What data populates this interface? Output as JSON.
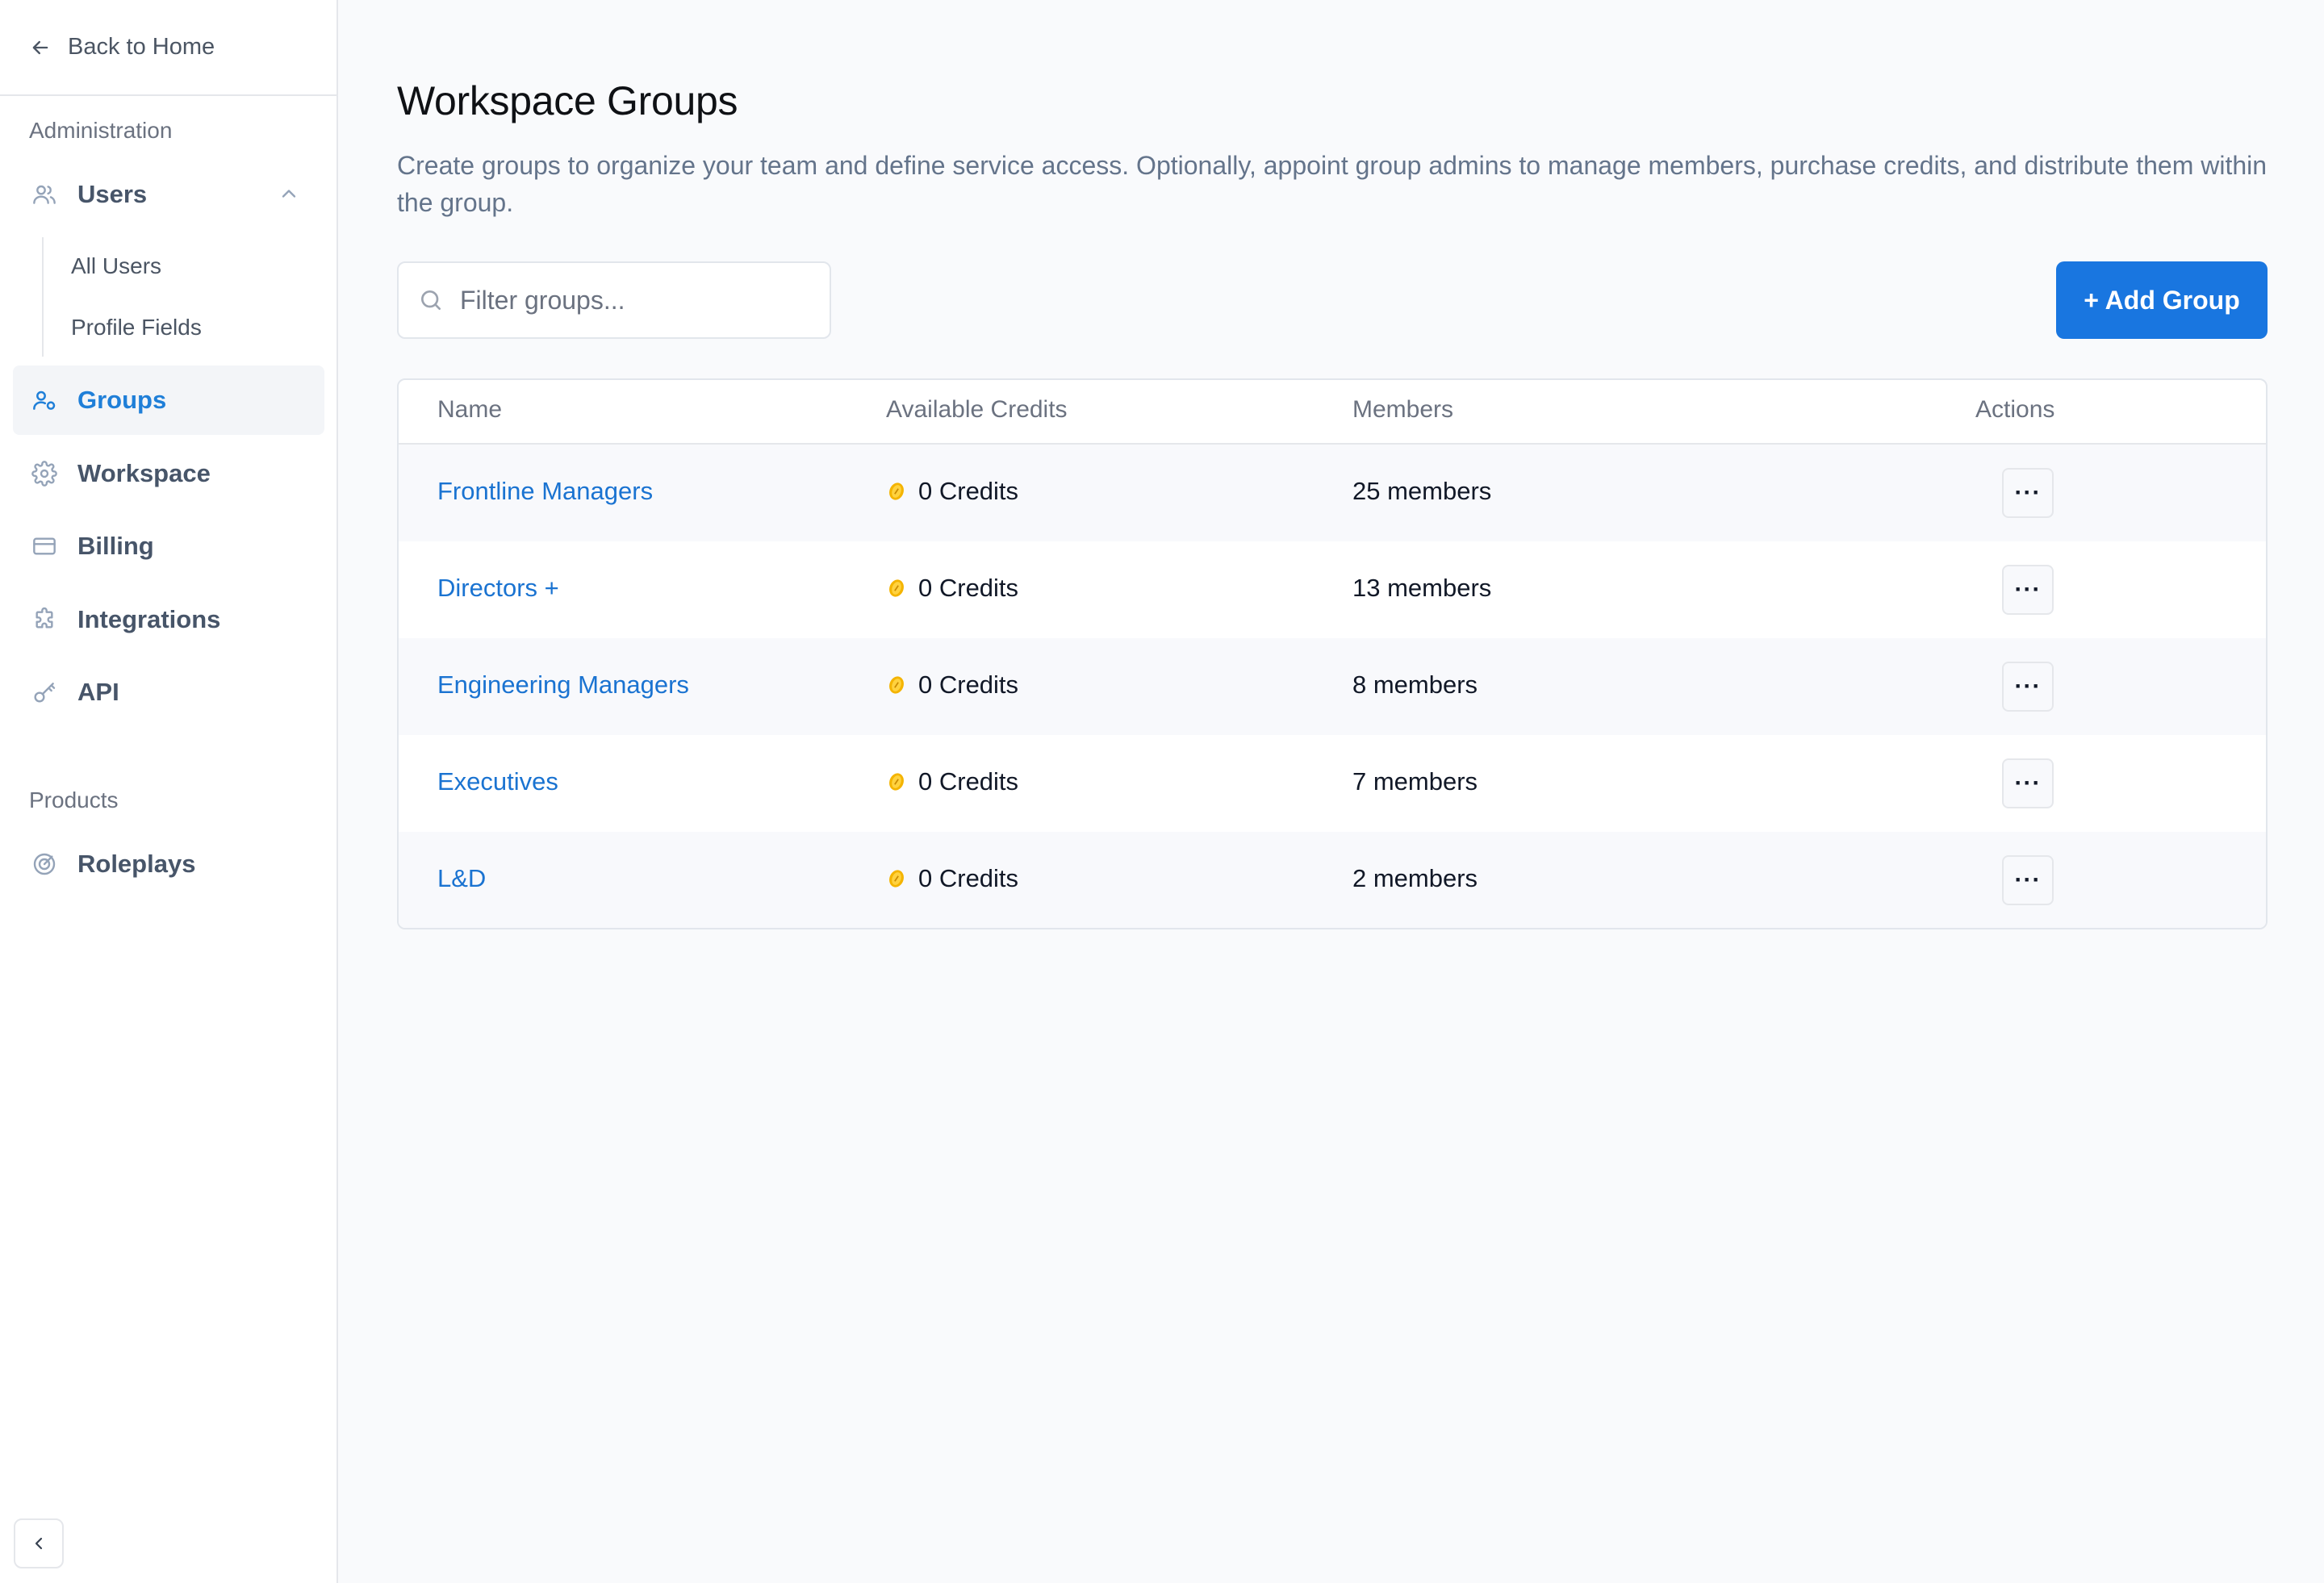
{
  "sidebar": {
    "back_label": "Back to Home",
    "section_admin": "Administration",
    "users_label": "Users",
    "sub_items": [
      "All Users",
      "Profile Fields"
    ],
    "items": [
      "Groups",
      "Workspace",
      "Billing",
      "Integrations",
      "API"
    ],
    "section_products": "Products",
    "products": [
      "Roleplays"
    ],
    "active_item": "Groups",
    "accent_color": "#1f7fd8"
  },
  "main": {
    "title": "Workspace Groups",
    "description": "Create groups to organize your team and define service access. Optionally, appoint group admins to manage members, purchase credits, and distribute them within the group.",
    "search_placeholder": "Filter groups...",
    "add_button": "+ Add Group",
    "columns": [
      "Name",
      "Available Credits",
      "Members",
      "Actions"
    ],
    "rows": [
      {
        "name": "Frontline Managers",
        "credits": "0 Credits",
        "members": "25 members",
        "action": "···"
      },
      {
        "name": "Directors +",
        "credits": "0 Credits",
        "members": "13 members",
        "action": "···"
      },
      {
        "name": "Engineering Managers",
        "credits": "0 Credits",
        "members": "8 members",
        "action": "···"
      },
      {
        "name": "Executives",
        "credits": "0 Credits",
        "members": "7 members",
        "action": "···"
      },
      {
        "name": "L&D",
        "credits": "0 Credits",
        "members": "2 members",
        "action": "···"
      }
    ],
    "button_color": "#1976e0",
    "link_color": "#1a73d1"
  }
}
